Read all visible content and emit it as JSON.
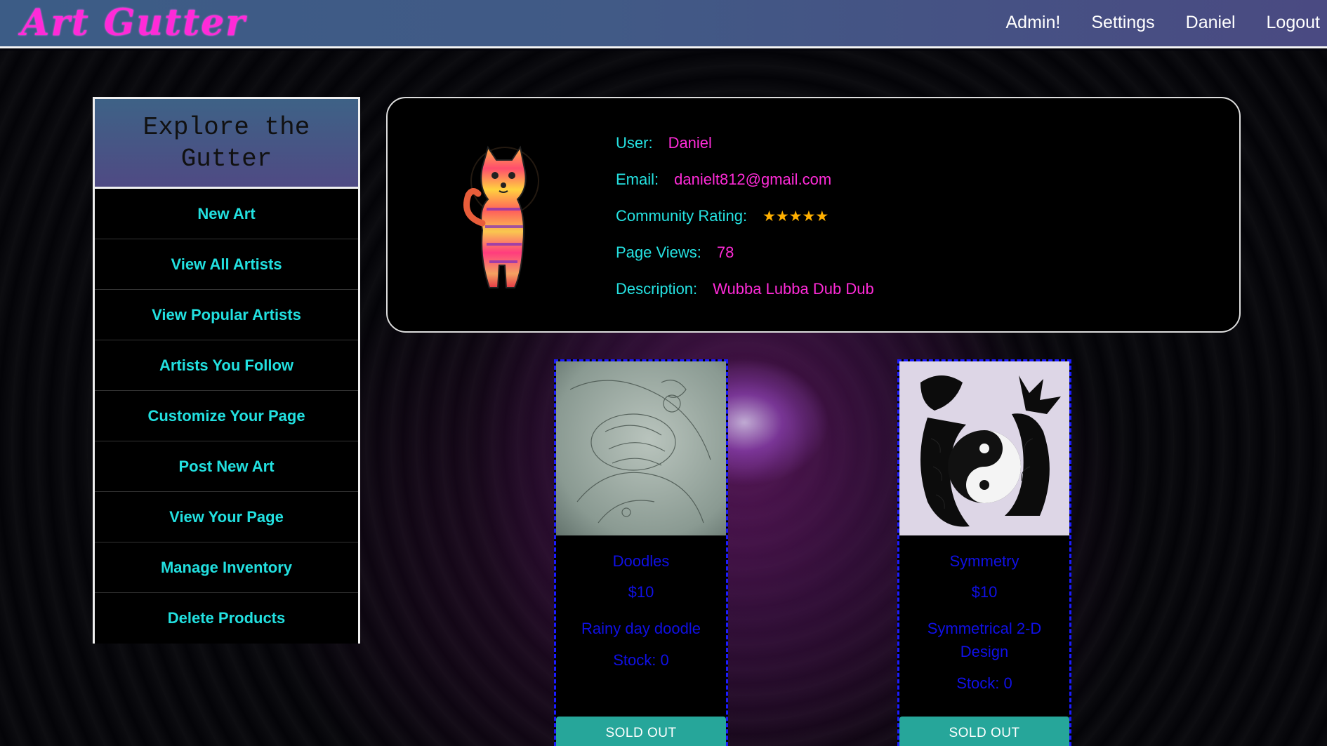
{
  "header": {
    "logo": "Art Gutter",
    "nav": [
      "Admin!",
      "Settings",
      "Daniel",
      "Logout"
    ]
  },
  "sidebar": {
    "title": "Explore the Gutter",
    "items": [
      "New Art",
      "View All Artists",
      "View Popular Artists",
      "Artists You Follow",
      "Customize Your Page",
      "Post New Art",
      "View Your Page",
      "Manage Inventory",
      "Delete Products"
    ]
  },
  "profile": {
    "user_label": "User:",
    "user": "Daniel",
    "email_label": "Email:",
    "email": "danielt812@gmail.com",
    "rating_label": "Community Rating:",
    "rating": 5,
    "rating_max": 5,
    "rating_stars": "★★★★★",
    "views_label": "Page Views:",
    "views": "78",
    "description_label": "Description:",
    "description": "Wubba Lubba Dub Dub"
  },
  "products": [
    {
      "title": "Doodles",
      "price": "$10",
      "description": "Rainy day doodle",
      "stock": "Stock: 0",
      "button": "SOLD OUT"
    },
    {
      "title": "Symmetry",
      "price": "$10",
      "description": "Symmetrical 2-D Design",
      "stock": "Stock: 0",
      "button": "SOLD OUT"
    }
  ],
  "colors": {
    "accent_cyan": "#22e0e0",
    "accent_pink": "#ff2bd8",
    "card_text": "#1010e6",
    "sold_button": "#26a69a"
  }
}
